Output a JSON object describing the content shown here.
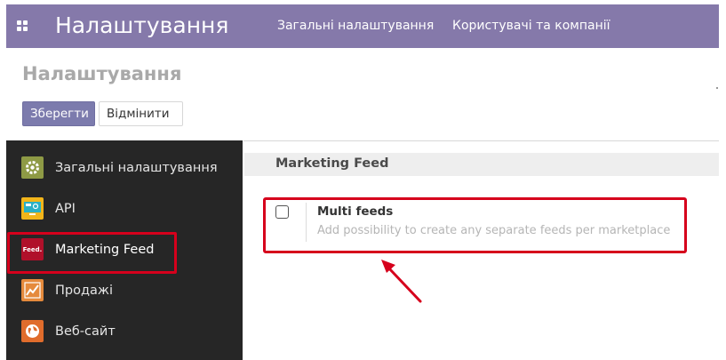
{
  "topbar": {
    "app_title": "Налаштування",
    "nav": [
      "Загальні налаштування",
      "Користувачі та компанії"
    ],
    "icon": "apps-grid-icon",
    "color": "#8579aa"
  },
  "page": {
    "title": "Налаштування",
    "save_label": "Зберегти",
    "cancel_label": "Відмінити"
  },
  "sidebar": {
    "items": [
      {
        "label": "Загальні налаштування",
        "icon": "gear-icon"
      },
      {
        "label": "API",
        "icon": "api-icon"
      },
      {
        "label": "Marketing Feed",
        "icon": "feed-icon",
        "icon_text": "Feed.",
        "active": true
      },
      {
        "label": "Продажі",
        "icon": "sales-chart-icon"
      },
      {
        "label": "Веб-сайт",
        "icon": "globe-icon"
      }
    ]
  },
  "section": {
    "title": "Marketing Feed",
    "setting": {
      "title": "Multi feeds",
      "description": "Add possibility to create any separate feeds per marketplace",
      "checked": false
    }
  },
  "colors": {
    "accent": "#7c7bad",
    "highlight": "#d6001c",
    "sidebar_bg": "#262626"
  }
}
